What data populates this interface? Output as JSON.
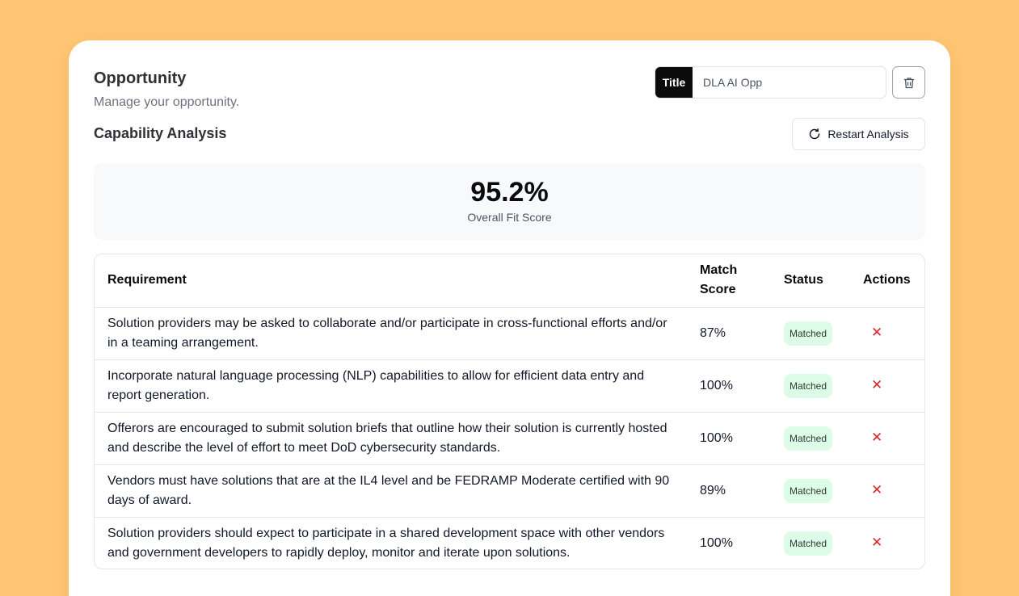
{
  "header": {
    "title": "Opportunity",
    "subtitle": "Manage your opportunity.",
    "title_tag": "Title",
    "title_value": "DLA AI Opp"
  },
  "analysis": {
    "section_title": "Capability Analysis",
    "restart_label": "Restart Analysis",
    "overall_score": "95.2%",
    "overall_label": "Overall Fit Score"
  },
  "table": {
    "columns": [
      "Requirement",
      "Match Score",
      "Status",
      "Actions"
    ],
    "rows": [
      {
        "requirement": "Solution providers may be asked to collaborate and/or participate in cross-functional efforts and/or in a teaming arrangement.",
        "score": "87%",
        "status": "Matched"
      },
      {
        "requirement": "Incorporate natural language processing (NLP) capabilities to allow for efficient data entry and report generation.",
        "score": "100%",
        "status": "Matched"
      },
      {
        "requirement": "Offerors are encouraged to submit solution briefs that outline how their solution is currently hosted and describe the level of effort to meet DoD cybersecurity standards.",
        "score": "100%",
        "status": "Matched"
      },
      {
        "requirement": "Vendors must have solutions that are at the IL4 level and be FEDRAMP Moderate certified with 90 days of award.",
        "score": "89%",
        "status": "Matched"
      },
      {
        "requirement": "Solution providers should expect to participate in a shared development space with other vendors and government developers to rapidly deploy, monitor and iterate upon solutions.",
        "score": "100%",
        "status": "Matched"
      }
    ]
  },
  "icons": {
    "trash": "trash-icon",
    "restart": "refresh-icon",
    "remove": "close-icon"
  },
  "colors": {
    "background": "#ffc773",
    "badge_bg": "#dcfce7",
    "remove": "#dc2626"
  }
}
